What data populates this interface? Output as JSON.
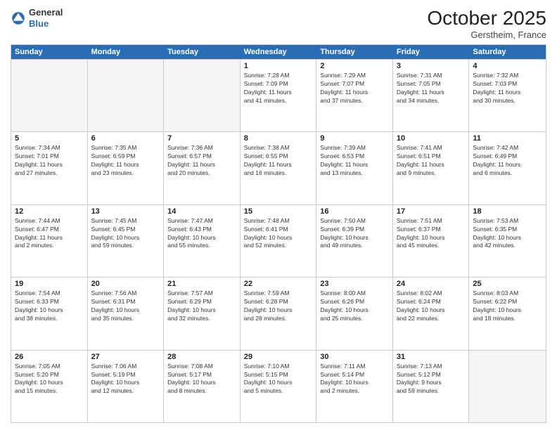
{
  "logo": {
    "general": "General",
    "blue": "Blue"
  },
  "header": {
    "month": "October 2025",
    "location": "Gerstheim, France"
  },
  "days": [
    "Sunday",
    "Monday",
    "Tuesday",
    "Wednesday",
    "Thursday",
    "Friday",
    "Saturday"
  ],
  "rows": [
    [
      {
        "day": "",
        "info": [],
        "empty": true
      },
      {
        "day": "",
        "info": [],
        "empty": true
      },
      {
        "day": "",
        "info": [],
        "empty": true
      },
      {
        "day": "1",
        "info": [
          "Sunrise: 7:28 AM",
          "Sunset: 7:09 PM",
          "Daylight: 11 hours",
          "and 41 minutes."
        ]
      },
      {
        "day": "2",
        "info": [
          "Sunrise: 7:29 AM",
          "Sunset: 7:07 PM",
          "Daylight: 11 hours",
          "and 37 minutes."
        ]
      },
      {
        "day": "3",
        "info": [
          "Sunrise: 7:31 AM",
          "Sunset: 7:05 PM",
          "Daylight: 11 hours",
          "and 34 minutes."
        ]
      },
      {
        "day": "4",
        "info": [
          "Sunrise: 7:32 AM",
          "Sunset: 7:03 PM",
          "Daylight: 11 hours",
          "and 30 minutes."
        ]
      }
    ],
    [
      {
        "day": "5",
        "info": [
          "Sunrise: 7:34 AM",
          "Sunset: 7:01 PM",
          "Daylight: 11 hours",
          "and 27 minutes."
        ]
      },
      {
        "day": "6",
        "info": [
          "Sunrise: 7:35 AM",
          "Sunset: 6:59 PM",
          "Daylight: 11 hours",
          "and 23 minutes."
        ]
      },
      {
        "day": "7",
        "info": [
          "Sunrise: 7:36 AM",
          "Sunset: 6:57 PM",
          "Daylight: 11 hours",
          "and 20 minutes."
        ]
      },
      {
        "day": "8",
        "info": [
          "Sunrise: 7:38 AM",
          "Sunset: 6:55 PM",
          "Daylight: 11 hours",
          "and 16 minutes."
        ]
      },
      {
        "day": "9",
        "info": [
          "Sunrise: 7:39 AM",
          "Sunset: 6:53 PM",
          "Daylight: 11 hours",
          "and 13 minutes."
        ]
      },
      {
        "day": "10",
        "info": [
          "Sunrise: 7:41 AM",
          "Sunset: 6:51 PM",
          "Daylight: 11 hours",
          "and 9 minutes."
        ]
      },
      {
        "day": "11",
        "info": [
          "Sunrise: 7:42 AM",
          "Sunset: 6:49 PM",
          "Daylight: 11 hours",
          "and 6 minutes."
        ]
      }
    ],
    [
      {
        "day": "12",
        "info": [
          "Sunrise: 7:44 AM",
          "Sunset: 6:47 PM",
          "Daylight: 11 hours",
          "and 2 minutes."
        ]
      },
      {
        "day": "13",
        "info": [
          "Sunrise: 7:45 AM",
          "Sunset: 6:45 PM",
          "Daylight: 10 hours",
          "and 59 minutes."
        ]
      },
      {
        "day": "14",
        "info": [
          "Sunrise: 7:47 AM",
          "Sunset: 6:43 PM",
          "Daylight: 10 hours",
          "and 55 minutes."
        ]
      },
      {
        "day": "15",
        "info": [
          "Sunrise: 7:48 AM",
          "Sunset: 6:41 PM",
          "Daylight: 10 hours",
          "and 52 minutes."
        ]
      },
      {
        "day": "16",
        "info": [
          "Sunrise: 7:50 AM",
          "Sunset: 6:39 PM",
          "Daylight: 10 hours",
          "and 49 minutes."
        ]
      },
      {
        "day": "17",
        "info": [
          "Sunrise: 7:51 AM",
          "Sunset: 6:37 PM",
          "Daylight: 10 hours",
          "and 45 minutes."
        ]
      },
      {
        "day": "18",
        "info": [
          "Sunrise: 7:53 AM",
          "Sunset: 6:35 PM",
          "Daylight: 10 hours",
          "and 42 minutes."
        ]
      }
    ],
    [
      {
        "day": "19",
        "info": [
          "Sunrise: 7:54 AM",
          "Sunset: 6:33 PM",
          "Daylight: 10 hours",
          "and 38 minutes."
        ]
      },
      {
        "day": "20",
        "info": [
          "Sunrise: 7:56 AM",
          "Sunset: 6:31 PM",
          "Daylight: 10 hours",
          "and 35 minutes."
        ]
      },
      {
        "day": "21",
        "info": [
          "Sunrise: 7:57 AM",
          "Sunset: 6:29 PM",
          "Daylight: 10 hours",
          "and 32 minutes."
        ]
      },
      {
        "day": "22",
        "info": [
          "Sunrise: 7:59 AM",
          "Sunset: 6:28 PM",
          "Daylight: 10 hours",
          "and 28 minutes."
        ]
      },
      {
        "day": "23",
        "info": [
          "Sunrise: 8:00 AM",
          "Sunset: 6:26 PM",
          "Daylight: 10 hours",
          "and 25 minutes."
        ]
      },
      {
        "day": "24",
        "info": [
          "Sunrise: 8:02 AM",
          "Sunset: 6:24 PM",
          "Daylight: 10 hours",
          "and 22 minutes."
        ]
      },
      {
        "day": "25",
        "info": [
          "Sunrise: 8:03 AM",
          "Sunset: 6:22 PM",
          "Daylight: 10 hours",
          "and 18 minutes."
        ]
      }
    ],
    [
      {
        "day": "26",
        "info": [
          "Sunrise: 7:05 AM",
          "Sunset: 5:20 PM",
          "Daylight: 10 hours",
          "and 15 minutes."
        ]
      },
      {
        "day": "27",
        "info": [
          "Sunrise: 7:06 AM",
          "Sunset: 5:19 PM",
          "Daylight: 10 hours",
          "and 12 minutes."
        ]
      },
      {
        "day": "28",
        "info": [
          "Sunrise: 7:08 AM",
          "Sunset: 5:17 PM",
          "Daylight: 10 hours",
          "and 8 minutes."
        ]
      },
      {
        "day": "29",
        "info": [
          "Sunrise: 7:10 AM",
          "Sunset: 5:15 PM",
          "Daylight: 10 hours",
          "and 5 minutes."
        ]
      },
      {
        "day": "30",
        "info": [
          "Sunrise: 7:11 AM",
          "Sunset: 5:14 PM",
          "Daylight: 10 hours",
          "and 2 minutes."
        ]
      },
      {
        "day": "31",
        "info": [
          "Sunrise: 7:13 AM",
          "Sunset: 5:12 PM",
          "Daylight: 9 hours",
          "and 59 minutes."
        ]
      },
      {
        "day": "",
        "info": [],
        "empty": true
      }
    ]
  ]
}
